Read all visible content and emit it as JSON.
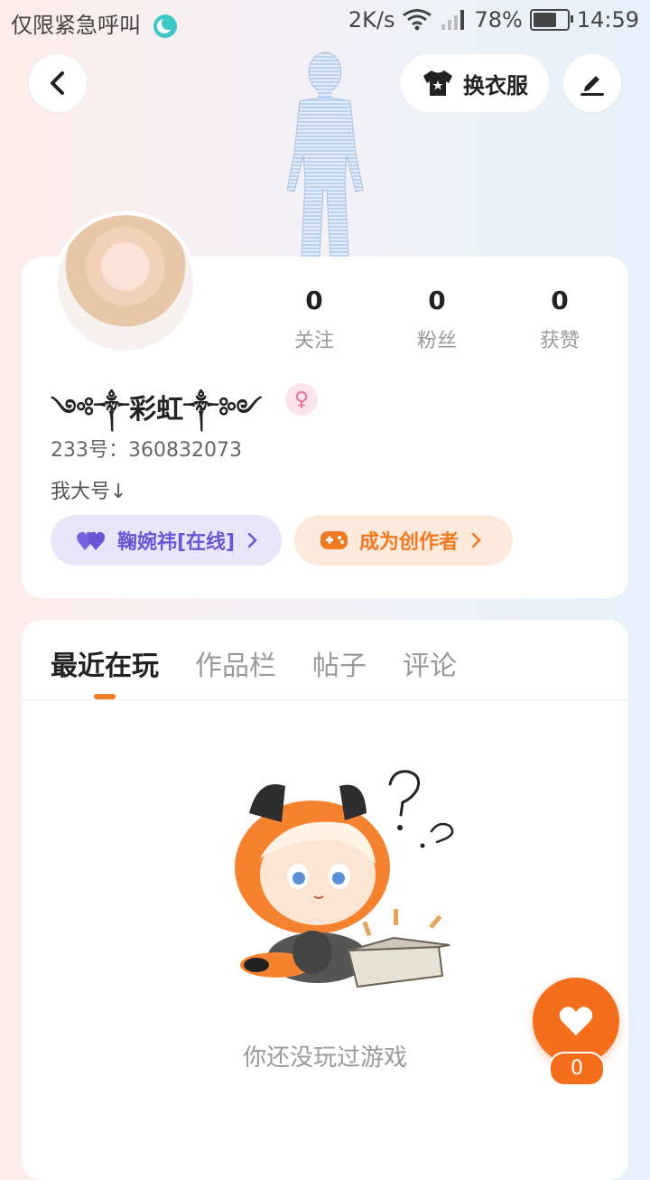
{
  "status_bar": {
    "carrier_text": "仅限紧急呼叫",
    "net_speed": "2K/s",
    "battery_pct": "78%",
    "battery_level": 0.78,
    "time": "14:59"
  },
  "header": {
    "dress_up_label": "换衣服"
  },
  "profile": {
    "stats": [
      {
        "value": "0",
        "label": "关注"
      },
      {
        "value": "0",
        "label": "粉丝"
      },
      {
        "value": "0",
        "label": "获赞"
      }
    ],
    "nickname": "༺༒彩虹༒༻",
    "gender_icon": "female-icon",
    "uid": "233号：360832073",
    "bio": "我大号↓",
    "friend_pill_label": "鞠婉祎[在线]",
    "creator_pill_label": "成为创作者"
  },
  "tabs": [
    {
      "label": "最近在玩",
      "active": true
    },
    {
      "label": "作品栏",
      "active": false
    },
    {
      "label": "帖子",
      "active": false
    },
    {
      "label": "评论",
      "active": false
    }
  ],
  "empty_state": {
    "text": "你还没玩过游戏"
  },
  "like_fab": {
    "count": "0"
  },
  "colors": {
    "accent_orange": "#f46e1c",
    "friend_purple": "#6a55d6",
    "gender_pink": "#f06d9b"
  }
}
